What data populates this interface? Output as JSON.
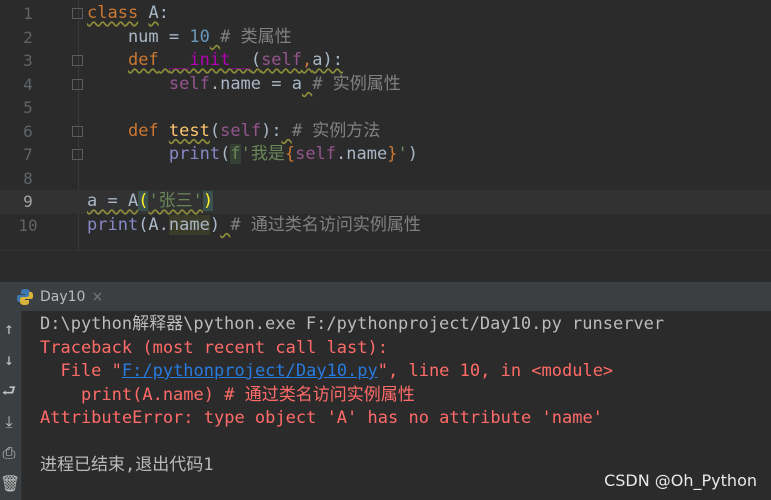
{
  "editor": {
    "current_line": 9,
    "lines": [
      {
        "n": "1",
        "tokens": [
          {
            "t": "class",
            "c": "kw w"
          },
          {
            "t": " "
          },
          {
            "t": "A",
            "c": "w"
          },
          {
            "t": ":"
          }
        ]
      },
      {
        "n": "2",
        "tokens": [
          {
            "t": "    num = "
          },
          {
            "t": "10",
            "c": "num"
          },
          {
            "t": " ",
            "c": "w"
          },
          {
            "t": "# 类属性",
            "c": "cm"
          }
        ]
      },
      {
        "n": "3",
        "tokens": [
          {
            "t": "    "
          },
          {
            "t": "def",
            "c": "kw w"
          },
          {
            "t": " ",
            "c": "w"
          },
          {
            "t": "__init__",
            "c": "magic w"
          },
          {
            "t": "(",
            "c": "w"
          },
          {
            "t": "self",
            "c": "self w"
          },
          {
            "t": ",",
            "c": "kw w"
          },
          {
            "t": "a):",
            "c": "w"
          }
        ]
      },
      {
        "n": "4",
        "tokens": [
          {
            "t": "        "
          },
          {
            "t": "self",
            "c": "self"
          },
          {
            "t": ".name = a"
          },
          {
            "t": " ",
            "c": "w"
          },
          {
            "t": "# 实例属性",
            "c": "cm"
          }
        ]
      },
      {
        "n": "5",
        "tokens": []
      },
      {
        "n": "6",
        "tokens": [
          {
            "t": "    "
          },
          {
            "t": "def",
            "c": "kw"
          },
          {
            "t": " "
          },
          {
            "t": "test",
            "c": "fn w"
          },
          {
            "t": "("
          },
          {
            "t": "self",
            "c": "self"
          },
          {
            "t": "):"
          },
          {
            "t": " ",
            "c": "w"
          },
          {
            "t": "# 实例方法",
            "c": "cm"
          }
        ]
      },
      {
        "n": "7",
        "tokens": [
          {
            "t": "        "
          },
          {
            "t": "print",
            "c": "bi"
          },
          {
            "t": "("
          },
          {
            "t": "f",
            "c": "str hl"
          },
          {
            "t": "'我是",
            "c": "str"
          },
          {
            "t": "{",
            "c": "kw"
          },
          {
            "t": "self",
            "c": "self"
          },
          {
            "t": ".name"
          },
          {
            "t": "}",
            "c": "kw"
          },
          {
            "t": "'",
            "c": "str"
          },
          {
            "t": ")"
          }
        ]
      },
      {
        "n": "8",
        "tokens": []
      },
      {
        "n": "9",
        "tokens": [
          {
            "t": "a = A",
            "c": "w"
          },
          {
            "t": "(",
            "c": "br"
          },
          {
            "t": "'张三'",
            "c": "str w"
          },
          {
            "t": ")",
            "c": "br"
          }
        ]
      },
      {
        "n": "10",
        "tokens": [
          {
            "t": "print",
            "c": "bi"
          },
          {
            "t": "(A."
          },
          {
            "t": "name",
            "c": "hl2"
          },
          {
            "t": ")"
          },
          {
            "t": " ",
            "c": "w"
          },
          {
            "t": "# 通过类名访问实例属性",
            "c": "cm"
          }
        ]
      }
    ]
  },
  "run_tab": {
    "label": "Day10",
    "close": "×"
  },
  "console": [
    {
      "tokens": [
        {
          "t": "D:\\python解释器\\python.exe F:/pythonproject/Day10.py runserver",
          "c": "c-n"
        }
      ]
    },
    {
      "tokens": [
        {
          "t": "Traceback (most recent call last):",
          "c": "c-e"
        }
      ]
    },
    {
      "tokens": [
        {
          "t": "  File \"",
          "c": "c-e"
        },
        {
          "t": "F:/pythonproject/Day10.py",
          "c": "c-l"
        },
        {
          "t": "\", line 10, in <module>",
          "c": "c-e"
        }
      ]
    },
    {
      "tokens": [
        {
          "t": "    print(A.name) # 通过类名访问实例属性",
          "c": "c-e"
        }
      ]
    },
    {
      "tokens": [
        {
          "t": "AttributeError: type object 'A' has no attribute 'name'",
          "c": "c-e"
        }
      ]
    },
    {
      "tokens": [
        {
          "t": " ",
          "c": "c-n"
        }
      ]
    },
    {
      "tokens": [
        {
          "t": "进程已结束,退出代码1",
          "c": "c-n"
        }
      ]
    }
  ],
  "toolbar": [
    {
      "icon": "↑",
      "name": "scroll-up-icon"
    },
    {
      "icon": "↓",
      "name": "scroll-down-icon"
    },
    {
      "icon": "⮐",
      "name": "soft-wrap-icon"
    },
    {
      "icon": "⤓",
      "name": "scroll-to-end-icon"
    },
    {
      "icon": "⎙",
      "name": "print-icon"
    },
    {
      "icon": "🗑",
      "name": "trash-icon"
    }
  ],
  "watermark": "CSDN @Oh_Python"
}
